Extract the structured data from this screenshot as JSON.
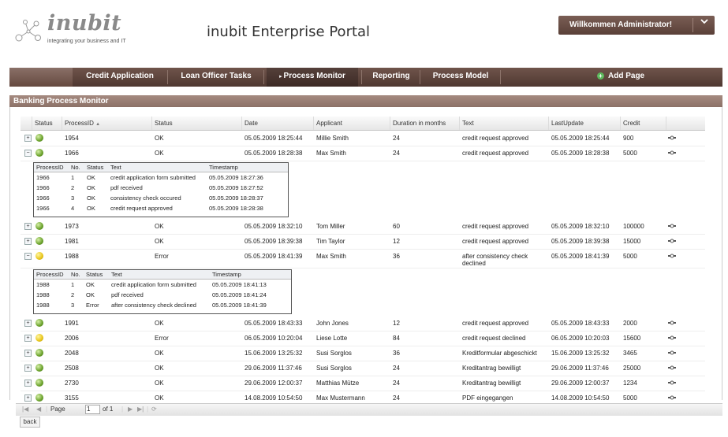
{
  "header": {
    "logo_word": "inubit",
    "logo_tagline": "integrating your business and IT",
    "portal_title": "inubit Enterprise Portal",
    "welcome": "Willkommen Administrator!"
  },
  "nav": {
    "items": [
      {
        "label": "Credit Application"
      },
      {
        "label": "Loan Officer Tasks"
      },
      {
        "label": "Process Monitor",
        "active": true
      },
      {
        "label": "Reporting"
      },
      {
        "label": "Process Model"
      }
    ],
    "add_page": "Add Page"
  },
  "panel": {
    "title": "Banking Process Monitor"
  },
  "columns": [
    "Status",
    "ProcessID",
    "Status",
    "Date",
    "Applicant",
    "Duration in months",
    "Text",
    "LastUpdate",
    "Credit"
  ],
  "sort_indicator": "▲",
  "rows": [
    {
      "pid": "1954",
      "status": "OK",
      "date": "05.05.2009 18:25:44",
      "applicant": "Millie Smith",
      "duration": "24",
      "text": "credit request approved",
      "updated": "05.05.2009 18:25:44",
      "credit": "900",
      "light": "ok",
      "expanded": false
    },
    {
      "pid": "1966",
      "status": "OK",
      "date": "05.05.2009 18:28:38",
      "applicant": "Max Smith",
      "duration": "24",
      "text": "credit request approved",
      "updated": "05.05.2009 18:28:38",
      "credit": "5000",
      "light": "ok",
      "expanded": true
    },
    {
      "pid": "1973",
      "status": "OK",
      "date": "05.05.2009 18:32:10",
      "applicant": "Tom Miller",
      "duration": "60",
      "text": "credit request approved",
      "updated": "05.05.2009 18:32:10",
      "credit": "100000",
      "light": "ok",
      "expanded": false
    },
    {
      "pid": "1981",
      "status": "OK",
      "date": "05.05.2009 18:39:38",
      "applicant": "Tim Taylor",
      "duration": "12",
      "text": "credit request approved",
      "updated": "05.05.2009 18:39:38",
      "credit": "15000",
      "light": "ok",
      "expanded": false
    },
    {
      "pid": "1988",
      "status": "Error",
      "date": "05.05.2009 18:41:39",
      "applicant": "Max Smith",
      "duration": "36",
      "text": "after consistency check declined",
      "updated": "05.05.2009 18:41:39",
      "credit": "5000",
      "light": "err",
      "expanded": true
    },
    {
      "pid": "1991",
      "status": "OK",
      "date": "05.05.2009 18:43:33",
      "applicant": "John Jones",
      "duration": "12",
      "text": "credit request approved",
      "updated": "05.05.2009 18:43:33",
      "credit": "2000",
      "light": "ok",
      "expanded": false
    },
    {
      "pid": "2006",
      "status": "Error",
      "date": "06.05.2009 10:20:04",
      "applicant": "Liese Lotte",
      "duration": "84",
      "text": "credit request declined",
      "updated": "06.05.2009 10:20:03",
      "credit": "15600",
      "light": "err",
      "expanded": false
    },
    {
      "pid": "2048",
      "status": "OK",
      "date": "15.06.2009 13:25:32",
      "applicant": "Susi Sorglos",
      "duration": "36",
      "text": "Kreditformular abgeschickt",
      "updated": "15.06.2009 13:25:32",
      "credit": "3465",
      "light": "ok",
      "expanded": false
    },
    {
      "pid": "2508",
      "status": "OK",
      "date": "29.06.2009 11:37:46",
      "applicant": "Susi Sorglos",
      "duration": "24",
      "text": "Kreditantrag bewilligt",
      "updated": "29.06.2009 11:37:46",
      "credit": "25000",
      "light": "ok",
      "expanded": false
    },
    {
      "pid": "2730",
      "status": "OK",
      "date": "29.06.2009 12:00:37",
      "applicant": "Matthias Mütze",
      "duration": "24",
      "text": "Kreditantrag bewilligt",
      "updated": "29.06.2009 12:00:37",
      "credit": "1234",
      "light": "ok",
      "expanded": false
    },
    {
      "pid": "3155",
      "status": "OK",
      "date": "14.08.2009 10:54:50",
      "applicant": "Max Mustermann",
      "duration": "24",
      "text": "PDF eingegangen",
      "updated": "14.08.2009 10:54:50",
      "credit": "5000",
      "light": "ok",
      "expanded": false
    }
  ],
  "detail_columns": [
    "ProcessID",
    "No.",
    "Status",
    "Text",
    "Timestamp"
  ],
  "details": {
    "1966": [
      [
        "1966",
        "1",
        "OK",
        "credit application form submitted",
        "05.05.2009 18:27:36"
      ],
      [
        "1966",
        "2",
        "OK",
        "pdf received",
        "05.05.2009 18:27:52"
      ],
      [
        "1966",
        "3",
        "OK",
        "consistency check occured",
        "05.05.2009 18:28:37"
      ],
      [
        "1966",
        "4",
        "OK",
        "credit request approved",
        "05.05.2009 18:28:38"
      ]
    ],
    "1988": [
      [
        "1988",
        "1",
        "OK",
        "credit application form submitted",
        "05.05.2009 18:41:13"
      ],
      [
        "1988",
        "2",
        "OK",
        "pdf received",
        "05.05.2009 18:41:24"
      ],
      [
        "1988",
        "3",
        "Error",
        "after consistency check declined",
        "05.05.2009 18:41:39"
      ]
    ]
  },
  "pager": {
    "page_label": "Page",
    "page_value": "1",
    "of_label": "of 1",
    "first": "|◀",
    "prev": "◀",
    "next": "▶",
    "last": "▶|",
    "refresh": "⟳"
  },
  "back": "back",
  "icons": {
    "expand": "+",
    "collapse": "−",
    "action": "▪▪▪"
  },
  "colors": {
    "nav_bg": "#5a4038",
    "panel_head": "#9a7e74",
    "ok": "#6aa12b",
    "error": "#e8c51a"
  }
}
